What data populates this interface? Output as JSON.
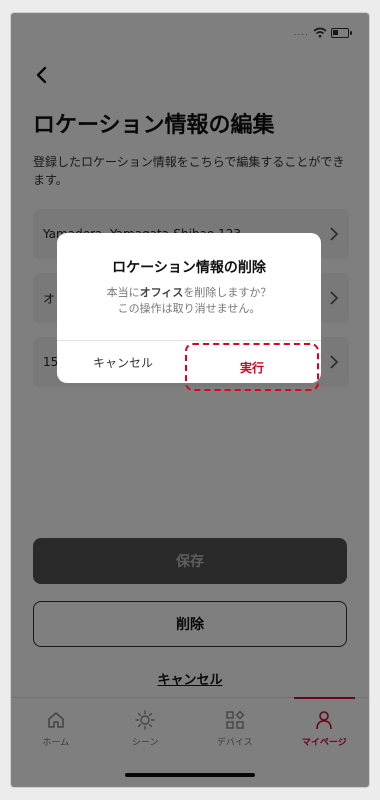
{
  "screen": {
    "title": "ロケーション情報の編集",
    "description": "登録したロケーション情報をこちらで編集することができます。"
  },
  "locations": [
    {
      "label": "Yamadera, Yamagata-Shibao 123"
    },
    {
      "label": "オ"
    },
    {
      "label": "15"
    }
  ],
  "buttons": {
    "save": "保存",
    "delete": "削除",
    "cancel": "キャンセル"
  },
  "tabs": [
    {
      "label": "ホーム",
      "icon": "home-icon"
    },
    {
      "label": "シーン",
      "icon": "scene-sun-icon"
    },
    {
      "label": "デバイス",
      "icon": "devices-grid-icon"
    },
    {
      "label": "マイページ",
      "icon": "person-icon",
      "active": true
    }
  ],
  "dialog": {
    "title": "ロケーション情報の削除",
    "message_prefix": "本当に",
    "message_bold": "オフィス",
    "message_suffix": "を削除しますか？",
    "message_line2": "この操作は取り消せません。",
    "cancel_label": "キャンセル",
    "execute_label": "実行"
  },
  "colors": {
    "accent": "#c8102e",
    "highlight": "#e1001e"
  }
}
